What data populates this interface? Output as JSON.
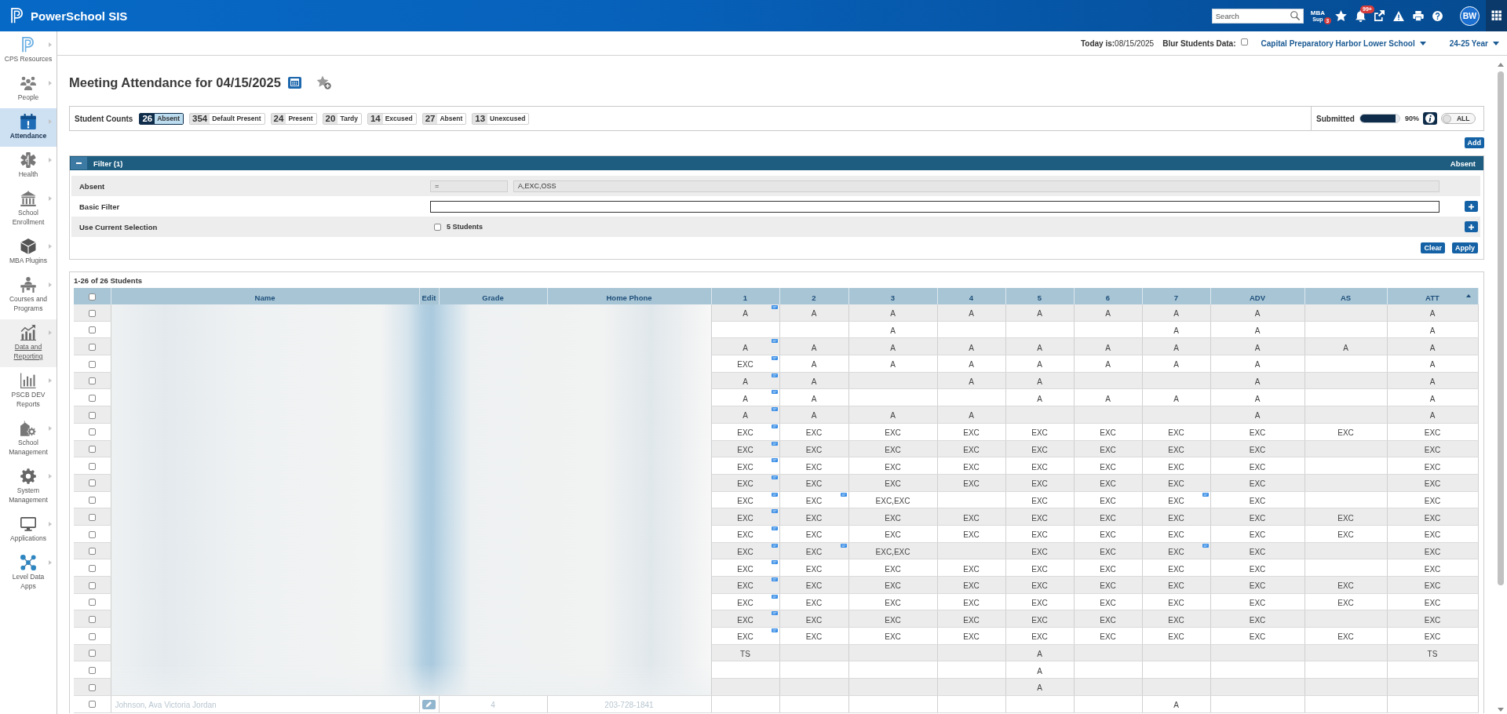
{
  "top_bar": {
    "product": "PowerSchool SIS",
    "search": {
      "placeholder": "Search"
    },
    "mba": {
      "label": "MBA",
      "sublabel": "Sup",
      "badge": "3"
    },
    "notifications": {
      "badge": "99+"
    },
    "avatar": "BW"
  },
  "header": {
    "today": "**Today is:**08/15/2025",
    "blur": {
      "label": "Blur Students Data:",
      "checked": false
    },
    "school": "Capital Preparatory Harbor Lower School",
    "term": "24-25 Year"
  },
  "sidebar": {
    "items": [
      {
        "kind": "logo",
        "label": "CPS Resources",
        "selected": false,
        "highlighted": false
      },
      {
        "kind": "people",
        "label": "People",
        "selected": false,
        "highlighted": false
      },
      {
        "kind": "calendar",
        "label": "Attendance",
        "selected": true,
        "highlighted": false
      },
      {
        "kind": "health",
        "label": "Health",
        "selected": false,
        "highlighted": false
      },
      {
        "kind": "school",
        "label": "School Enrollment",
        "selected": false,
        "highlighted": false
      },
      {
        "kind": "cube",
        "label": "MBA Plugins",
        "selected": false,
        "highlighted": false
      },
      {
        "kind": "desk",
        "label": "Courses and Programs",
        "selected": false,
        "highlighted": false
      },
      {
        "kind": "trend",
        "label": "Data and Reporting",
        "selected": false,
        "highlighted": true
      },
      {
        "kind": "bars",
        "label": "PSCB DEV Reports",
        "selected": false,
        "highlighted": false
      },
      {
        "kind": "campus",
        "label": "School Management",
        "selected": false,
        "highlighted": false
      },
      {
        "kind": "gear",
        "label": "System Management",
        "selected": false,
        "highlighted": false
      },
      {
        "kind": "monitor",
        "label": "Applications",
        "selected": false,
        "highlighted": false
      },
      {
        "kind": "network",
        "label": "Level Data Apps",
        "selected": false,
        "highlighted": false
      }
    ]
  },
  "page": {
    "title": "Meeting Attendance for 04/15/2025"
  },
  "counts": {
    "label": "Student Counts",
    "chips": [
      {
        "count": "26",
        "label": "Absent",
        "selected": true
      },
      {
        "count": "354",
        "label": "Default Present",
        "selected": false
      },
      {
        "count": "24",
        "label": "Present",
        "selected": false
      },
      {
        "count": "20",
        "label": "Tardy",
        "selected": false
      },
      {
        "count": "14",
        "label": "Excused",
        "selected": false
      },
      {
        "count": "27",
        "label": "Absent",
        "selected": false
      },
      {
        "count": "13",
        "label": "Unexcused",
        "selected": false
      }
    ],
    "submitted": {
      "label": "Submitted",
      "level": 0.9,
      "reading": "90%"
    },
    "toggle": {
      "label": "ALL",
      "on": false
    }
  },
  "add_button": "Add",
  "filter": {
    "title": "Filter (1)",
    "summary": "Absent",
    "expanded": true,
    "rows": [
      {
        "kind": "condition",
        "label": "Absent",
        "operator": "=",
        "value": "A,EXC,OSS"
      },
      {
        "kind": "text",
        "label": "Basic Filter"
      },
      {
        "kind": "selection",
        "label": "Use Current Selection",
        "checked": false,
        "note": "5 Students"
      }
    ],
    "buttons": [
      "Clear",
      "Apply"
    ]
  },
  "table": {
    "summary": "1-26 of 26 Students",
    "select_all": {
      "checked": false
    },
    "student_info_blurred": true,
    "columns": [
      {
        "label": "Name",
        "sorted": false
      },
      {
        "label": "Edit",
        "sorted": false
      },
      {
        "label": "Grade",
        "sorted": false
      },
      {
        "label": "Home Phone",
        "sorted": false
      },
      {
        "label": "1",
        "sorted": false
      },
      {
        "label": "2",
        "sorted": false
      },
      {
        "label": "3",
        "sorted": false
      },
      {
        "label": "4",
        "sorted": false
      },
      {
        "label": "5",
        "sorted": false
      },
      {
        "label": "6",
        "sorted": false
      },
      {
        "label": "7",
        "sorted": false
      },
      {
        "label": "ADV",
        "sorted": false
      },
      {
        "label": "AS",
        "sorted": false
      },
      {
        "label": "ATT",
        "sorted": true
      }
    ],
    "rows": [
      {
        "checked": false,
        "cells": [
          "",
          "",
          "",
          "",
          "A",
          "A",
          "A",
          "A",
          "A",
          "A",
          "A",
          "A",
          "",
          "A"
        ],
        "notes": [
          true,
          false,
          false,
          false,
          false,
          false,
          false,
          false,
          false,
          false
        ]
      },
      {
        "checked": false,
        "cells": [
          "",
          "",
          "",
          "",
          "",
          "",
          "A",
          "",
          "",
          "",
          "A",
          "A",
          "",
          "A"
        ],
        "notes": [
          false,
          false,
          false,
          false,
          false,
          false,
          false,
          false,
          false,
          false
        ]
      },
      {
        "checked": false,
        "cells": [
          "",
          "",
          "",
          "",
          "A",
          "A",
          "A",
          "A",
          "A",
          "A",
          "A",
          "A",
          "A",
          "A"
        ],
        "notes": [
          true,
          false,
          false,
          false,
          false,
          false,
          false,
          false,
          false,
          false
        ]
      },
      {
        "checked": false,
        "cells": [
          "",
          "",
          "",
          "",
          "EXC",
          "A",
          "A",
          "A",
          "A",
          "A",
          "A",
          "A",
          "",
          "A"
        ],
        "notes": [
          true,
          false,
          false,
          false,
          false,
          false,
          false,
          false,
          false,
          false
        ]
      },
      {
        "checked": false,
        "cells": [
          "",
          "",
          "",
          "",
          "A",
          "A",
          "",
          "A",
          "A",
          "",
          "",
          "A",
          "",
          "A"
        ],
        "notes": [
          true,
          false,
          false,
          false,
          false,
          false,
          false,
          false,
          false,
          false
        ]
      },
      {
        "checked": false,
        "cells": [
          "",
          "",
          "",
          "",
          "A",
          "A",
          "",
          "",
          "A",
          "A",
          "A",
          "A",
          "",
          "A"
        ],
        "notes": [
          true,
          false,
          false,
          false,
          false,
          false,
          false,
          false,
          false,
          false
        ]
      },
      {
        "checked": false,
        "cells": [
          "",
          "",
          "",
          "",
          "A",
          "A",
          "A",
          "A",
          "",
          "",
          "",
          "A",
          "",
          "A"
        ],
        "notes": [
          true,
          false,
          false,
          false,
          false,
          false,
          false,
          false,
          false,
          false
        ]
      },
      {
        "checked": false,
        "cells": [
          "",
          "",
          "",
          "",
          "EXC",
          "EXC",
          "EXC",
          "EXC",
          "EXC",
          "EXC",
          "EXC",
          "EXC",
          "EXC",
          "EXC"
        ],
        "notes": [
          true,
          false,
          false,
          false,
          false,
          false,
          false,
          false,
          false,
          false
        ]
      },
      {
        "checked": false,
        "cells": [
          "",
          "",
          "",
          "",
          "EXC",
          "EXC",
          "EXC",
          "EXC",
          "EXC",
          "EXC",
          "EXC",
          "EXC",
          "",
          "EXC"
        ],
        "notes": [
          true,
          false,
          false,
          false,
          false,
          false,
          false,
          false,
          false,
          false
        ]
      },
      {
        "checked": false,
        "cells": [
          "",
          "",
          "",
          "",
          "EXC",
          "EXC",
          "EXC",
          "EXC",
          "EXC",
          "EXC",
          "EXC",
          "EXC",
          "",
          "EXC"
        ],
        "notes": [
          true,
          false,
          false,
          false,
          false,
          false,
          false,
          false,
          false,
          false
        ]
      },
      {
        "checked": false,
        "cells": [
          "",
          "",
          "",
          "",
          "EXC",
          "EXC",
          "EXC",
          "EXC",
          "EXC",
          "EXC",
          "EXC",
          "EXC",
          "",
          "EXC"
        ],
        "notes": [
          true,
          false,
          false,
          false,
          false,
          false,
          false,
          false,
          false,
          false
        ]
      },
      {
        "checked": false,
        "cells": [
          "",
          "",
          "",
          "",
          "EXC",
          "EXC",
          "EXC,EXC",
          "",
          "EXC",
          "EXC",
          "EXC",
          "EXC",
          "",
          "EXC"
        ],
        "notes": [
          true,
          true,
          false,
          false,
          false,
          false,
          true,
          false,
          false,
          false
        ]
      },
      {
        "checked": false,
        "cells": [
          "",
          "",
          "",
          "",
          "EXC",
          "EXC",
          "EXC",
          "EXC",
          "EXC",
          "EXC",
          "EXC",
          "EXC",
          "EXC",
          "EXC"
        ],
        "notes": [
          true,
          false,
          false,
          false,
          false,
          false,
          false,
          false,
          false,
          false
        ]
      },
      {
        "checked": false,
        "cells": [
          "",
          "",
          "",
          "",
          "EXC",
          "EXC",
          "EXC",
          "EXC",
          "EXC",
          "EXC",
          "EXC",
          "EXC",
          "EXC",
          "EXC"
        ],
        "notes": [
          true,
          false,
          false,
          false,
          false,
          false,
          false,
          false,
          false,
          false
        ]
      },
      {
        "checked": false,
        "cells": [
          "",
          "",
          "",
          "",
          "EXC",
          "EXC",
          "EXC,EXC",
          "",
          "EXC",
          "EXC",
          "EXC",
          "EXC",
          "",
          "EXC"
        ],
        "notes": [
          true,
          true,
          false,
          false,
          false,
          false,
          true,
          false,
          false,
          false
        ]
      },
      {
        "checked": false,
        "cells": [
          "",
          "",
          "",
          "",
          "EXC",
          "EXC",
          "EXC",
          "EXC",
          "EXC",
          "EXC",
          "EXC",
          "EXC",
          "",
          "EXC"
        ],
        "notes": [
          true,
          false,
          false,
          false,
          false,
          false,
          false,
          false,
          false,
          false
        ]
      },
      {
        "checked": false,
        "cells": [
          "",
          "",
          "",
          "",
          "EXC",
          "EXC",
          "EXC",
          "EXC",
          "EXC",
          "EXC",
          "EXC",
          "EXC",
          "EXC",
          "EXC"
        ],
        "notes": [
          true,
          false,
          false,
          false,
          false,
          false,
          false,
          false,
          false,
          false
        ]
      },
      {
        "checked": false,
        "cells": [
          "",
          "",
          "",
          "",
          "EXC",
          "EXC",
          "EXC",
          "EXC",
          "EXC",
          "EXC",
          "EXC",
          "EXC",
          "EXC",
          "EXC"
        ],
        "notes": [
          true,
          false,
          false,
          false,
          false,
          false,
          false,
          false,
          false,
          false
        ]
      },
      {
        "checked": false,
        "cells": [
          "",
          "",
          "",
          "",
          "EXC",
          "EXC",
          "EXC",
          "EXC",
          "EXC",
          "EXC",
          "EXC",
          "EXC",
          "",
          "EXC"
        ],
        "notes": [
          true,
          false,
          false,
          false,
          false,
          false,
          false,
          false,
          false,
          false
        ]
      },
      {
        "checked": false,
        "cells": [
          "",
          "",
          "",
          "",
          "EXC",
          "EXC",
          "EXC",
          "EXC",
          "EXC",
          "EXC",
          "EXC",
          "EXC",
          "EXC",
          "EXC"
        ],
        "notes": [
          true,
          false,
          false,
          false,
          false,
          false,
          false,
          false,
          false,
          false
        ]
      },
      {
        "checked": false,
        "cells": [
          "",
          "",
          "",
          "",
          "TS",
          "",
          "",
          "",
          "A",
          "",
          "",
          "",
          "",
          "TS"
        ],
        "notes": [
          false,
          false,
          false,
          false,
          false,
          false,
          false,
          false,
          false,
          false
        ]
      },
      {
        "checked": false,
        "cells": [
          "",
          "",
          "",
          "",
          "",
          "",
          "",
          "",
          "A",
          "",
          "",
          "",
          "",
          ""
        ],
        "notes": [
          false,
          false,
          false,
          false,
          false,
          false,
          false,
          false,
          false,
          false
        ]
      },
      {
        "checked": false,
        "cells": [
          "",
          "",
          "",
          "",
          "",
          "",
          "",
          "",
          "A",
          "",
          "",
          "",
          "",
          ""
        ],
        "notes": [
          false,
          false,
          false,
          false,
          false,
          false,
          false,
          false,
          false,
          false
        ]
      },
      {
        "checked": false,
        "cells": [
          "Johnson, Ava Victoria Jordan",
          "",
          "4",
          "203-728-1841",
          "",
          "",
          "",
          "",
          "",
          "",
          "A",
          "",
          "",
          ""
        ],
        "notes": [
          false,
          false,
          false,
          false,
          false,
          false,
          false,
          false,
          false,
          false
        ]
      }
    ]
  }
}
